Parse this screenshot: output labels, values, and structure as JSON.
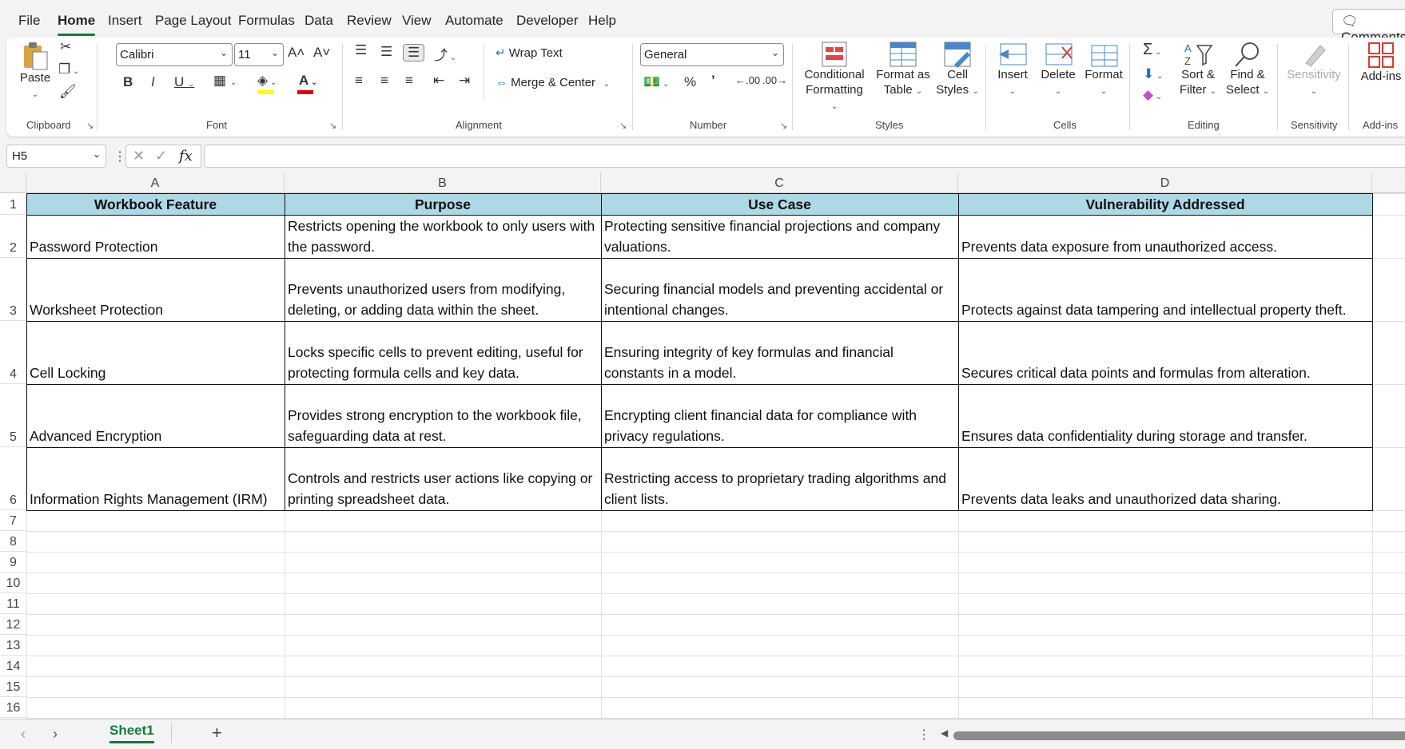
{
  "menu": {
    "items": [
      "File",
      "Home",
      "Insert",
      "Page Layout",
      "Formulas",
      "Data",
      "Review",
      "View",
      "Automate",
      "Developer",
      "Help"
    ],
    "active": "Home",
    "comments_label": "Comments"
  },
  "ribbon": {
    "clipboard": {
      "paste_label": "Paste",
      "group_label": "Clipboard"
    },
    "font": {
      "font_name": "Calibri",
      "font_size": "11",
      "group_label": "Font"
    },
    "alignment": {
      "wrap_text_label": "Wrap Text",
      "merge_center_label": "Merge & Center",
      "group_label": "Alignment"
    },
    "number": {
      "format": "General",
      "group_label": "Number"
    },
    "styles": {
      "conditional_formatting_label": "Conditional",
      "conditional_formatting_label2": "Formatting",
      "format_as_table_label": "Format as",
      "format_as_table_label2": "Table",
      "cell_styles_label": "Cell",
      "cell_styles_label2": "Styles",
      "group_label": "Styles"
    },
    "cells": {
      "insert_label": "Insert",
      "delete_label": "Delete",
      "format_label": "Format",
      "group_label": "Cells"
    },
    "editing": {
      "sort_filter_label": "Sort &",
      "sort_filter_label2": "Filter",
      "find_select_label": "Find &",
      "find_select_label2": "Select",
      "group_label": "Editing"
    },
    "sensitivity": {
      "label": "Sensitivity",
      "group_label": "Sensitivity"
    },
    "addins": {
      "label": "Add-ins",
      "group_label": "Add-ins"
    },
    "colors": {
      "highlight": "#ffff00",
      "font_color": "#e00000"
    }
  },
  "formula_bar": {
    "name_box": "H5",
    "fx_symbol": "fx",
    "value": ""
  },
  "sheet": {
    "columns": [
      "A",
      "B",
      "C",
      "D"
    ],
    "rows": [
      "1",
      "2",
      "3",
      "4",
      "5",
      "6",
      "7",
      "8",
      "9",
      "10",
      "11",
      "12",
      "13",
      "14",
      "15",
      "16"
    ],
    "header_row": [
      "Workbook Feature",
      "Purpose",
      "Use Case",
      "Vulnerability Addressed"
    ],
    "header_fill": "#add8e6",
    "data": [
      [
        "Password Protection",
        "Restricts opening the workbook to only users with the password.",
        "Protecting sensitive financial projections and company valuations.",
        "Prevents data exposure from unauthorized access."
      ],
      [
        "Worksheet Protection",
        "Prevents unauthorized users from modifying, deleting, or adding data within the sheet.",
        "Securing financial models and preventing accidental or intentional changes.",
        "Protects against data tampering and intellectual property theft."
      ],
      [
        "Cell Locking",
        "Locks specific cells to prevent editing, useful for protecting formula cells and key data.",
        "Ensuring integrity of key formulas and financial constants in a model.",
        "Secures critical data points and formulas from alteration."
      ],
      [
        "Advanced Encryption",
        "Provides strong encryption to the workbook file, safeguarding data at rest.",
        "Encrypting client financial data for compliance with privacy regulations.",
        "Ensures data confidentiality during storage and transfer."
      ],
      [
        "Information Rights Management (IRM)",
        "Controls and restricts user actions like copying or printing spreadsheet data.",
        "Restricting access to proprietary trading algorithms and client lists.",
        "Prevents data leaks and unauthorized data sharing."
      ]
    ]
  },
  "tabs": {
    "sheets": [
      "Sheet1"
    ],
    "add_label": "+"
  }
}
